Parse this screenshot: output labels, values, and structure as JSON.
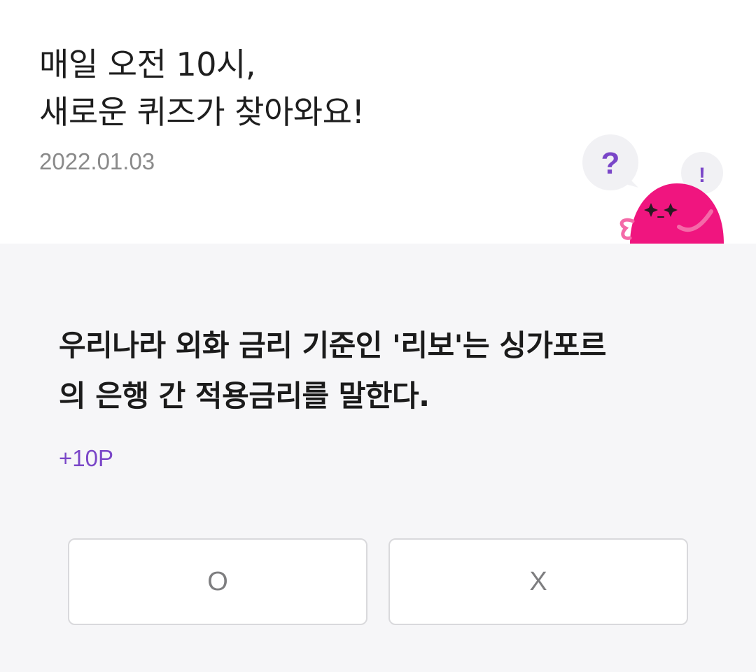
{
  "header": {
    "title_line1": "매일 오전 10시,",
    "title_line2": "새로운 퀴즈가 찾아와요!",
    "date": "2022.01.03"
  },
  "mascot": {
    "bubble_question": "?",
    "bubble_exclaim": "!",
    "body_color": "#f0157f",
    "accent_color": "#7a46c8"
  },
  "quiz": {
    "question_line1": "우리나라 외화 금리 기준인 '리보'는 싱가포르",
    "question_line2": "의 은행 간 적용금리를 말한다.",
    "points": "+10P",
    "options": {
      "o_label": "O",
      "x_label": "X"
    }
  }
}
